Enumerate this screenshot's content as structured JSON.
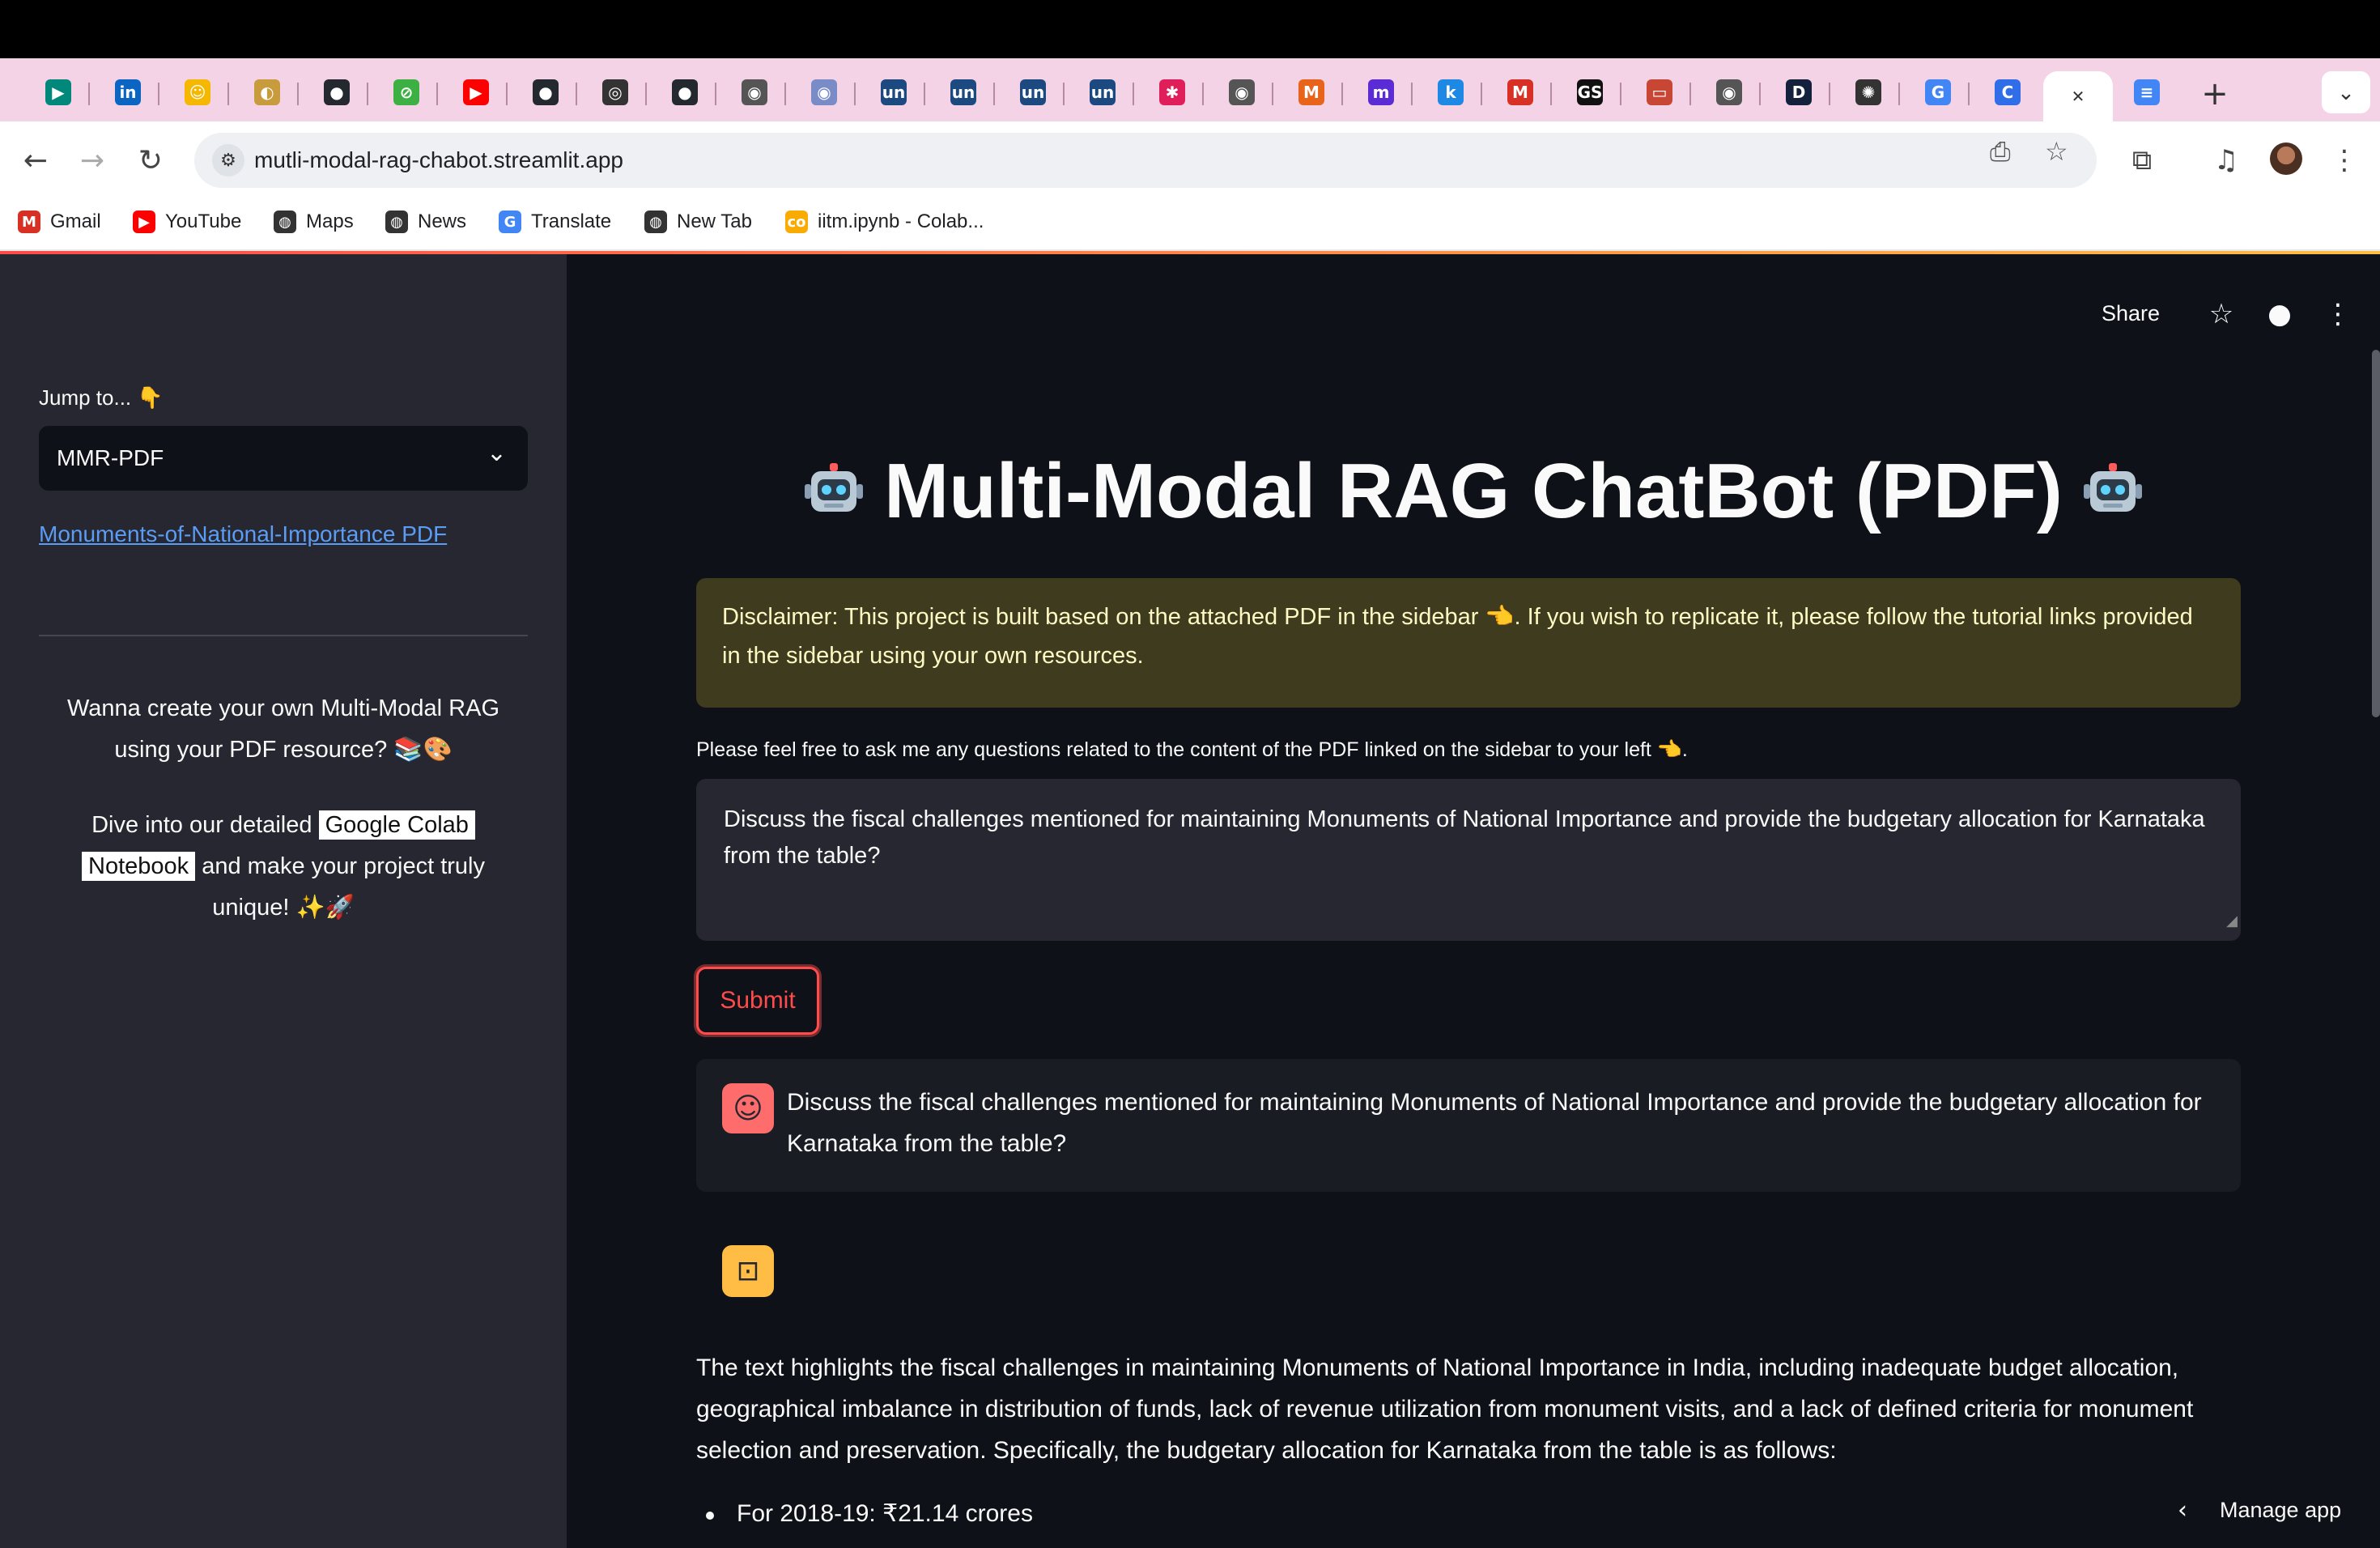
{
  "browser": {
    "tabs": [
      {
        "icon": "google-meet-icon",
        "glyph": "▶",
        "color": "#00897b"
      },
      {
        "icon": "linkedin-icon",
        "glyph": "in",
        "color": "#0a66c2"
      },
      {
        "icon": "huggingface-icon",
        "glyph": "☺",
        "color": "#f5b700"
      },
      {
        "icon": "colab-icon",
        "glyph": "◐",
        "color": "#c89b3c"
      },
      {
        "icon": "github-icon",
        "glyph": "●",
        "color": "#24292f"
      },
      {
        "icon": "green-app-icon",
        "glyph": "⊘",
        "color": "#3cb043"
      },
      {
        "icon": "youtube-icon",
        "glyph": "▶",
        "color": "#ff0000"
      },
      {
        "icon": "github-icon",
        "glyph": "●",
        "color": "#24292f"
      },
      {
        "icon": "openai-icon",
        "glyph": "◎",
        "color": "#333333"
      },
      {
        "icon": "github-icon",
        "glyph": "●",
        "color": "#24292f"
      },
      {
        "icon": "chrome-icon",
        "glyph": "◉",
        "color": "#555555"
      },
      {
        "icon": "chrome-canary-icon",
        "glyph": "◉",
        "color": "#7a8cc7"
      },
      {
        "icon": "unstop-icon",
        "glyph": "un",
        "color": "#1c4980"
      },
      {
        "icon": "unstop-icon",
        "glyph": "un",
        "color": "#1c4980"
      },
      {
        "icon": "unstop-icon",
        "glyph": "un",
        "color": "#1c4980"
      },
      {
        "icon": "unstop-icon",
        "glyph": "un",
        "color": "#1c4980"
      },
      {
        "icon": "slack-icon",
        "glyph": "✱",
        "color": "#e01e5a"
      },
      {
        "icon": "chrome-icon",
        "glyph": "◉",
        "color": "#555555"
      },
      {
        "icon": "orange-app-icon",
        "glyph": "M",
        "color": "#e8641b"
      },
      {
        "icon": "miro-icon",
        "glyph": "m",
        "color": "#5b2bd5"
      },
      {
        "icon": "k-app-icon",
        "glyph": "k",
        "color": "#1e88e5"
      },
      {
        "icon": "gmail-icon",
        "glyph": "M",
        "color": "#d93025"
      },
      {
        "icon": "gs-app-icon",
        "glyph": "GS",
        "color": "#111111"
      },
      {
        "icon": "oracle-icon",
        "glyph": "▭",
        "color": "#c74634"
      },
      {
        "icon": "chrome-icon",
        "glyph": "◉",
        "color": "#555555"
      },
      {
        "icon": "d-app-icon",
        "glyph": "D",
        "color": "#14213d"
      },
      {
        "icon": "chatgpt-icon",
        "glyph": "✺",
        "color": "#333333"
      },
      {
        "icon": "google-icon",
        "glyph": "G",
        "color": "#4285f4"
      },
      {
        "icon": "copilot-icon",
        "glyph": "C",
        "color": "#2f6ee8"
      },
      {
        "icon": "close-icon",
        "glyph": "✕",
        "color": "#333333",
        "active": true
      },
      {
        "icon": "docs-icon",
        "glyph": "≡",
        "color": "#4285f4"
      }
    ],
    "new_tab_glyph": "+",
    "tab_menu_glyph": "⌄",
    "url": "mutli-modal-rag-chabot.streamlit.app",
    "bookmarks": [
      {
        "label": "Gmail",
        "icon": "gmail-icon",
        "glyph": "M",
        "color": "#d93025"
      },
      {
        "label": "YouTube",
        "icon": "youtube-icon",
        "glyph": "▶",
        "color": "#ff0000"
      },
      {
        "label": "Maps",
        "icon": "globe-icon",
        "glyph": "◍",
        "color": "#333333"
      },
      {
        "label": "News",
        "icon": "globe-icon",
        "glyph": "◍",
        "color": "#333333"
      },
      {
        "label": "Translate",
        "icon": "translate-icon",
        "glyph": "G",
        "color": "#4285f4"
      },
      {
        "label": "New Tab",
        "icon": "globe-icon",
        "glyph": "◍",
        "color": "#333333"
      },
      {
        "label": "iitm.ipynb - Colab...",
        "icon": "colab-icon",
        "glyph": "co",
        "color": "#f9ab00"
      }
    ]
  },
  "sidebar": {
    "jump_label": "Jump to... 👇",
    "select_value": "MMR-PDF",
    "pdf_link": "Monuments-of-National-Importance PDF",
    "promo_line1": "Wanna create your own Multi-Modal RAG",
    "promo_line2": "using your PDF resource? 📚🎨",
    "dive_prefix": "Dive into our detailed",
    "colab_part1": "Google Colab",
    "colab_part2": "Notebook",
    "dive_suffix": "and make your project truly",
    "dive_end": "unique! ✨🚀"
  },
  "header": {
    "share": "Share"
  },
  "main": {
    "title": "Multi-Modal RAG ChatBot (PDF)",
    "disclaimer": "Disclaimer: This project is built based on the attached PDF in the sidebar 👈. If you wish to replicate it, please follow the tutorial links provided in the sidebar using your own resources.",
    "helper": "Please feel free to ask me any questions related to the content of the PDF linked on the sidebar to your left 👈.",
    "question_value": "Discuss the fiscal challenges mentioned for maintaining Monuments of National Importance and provide the budgetary allocation for Karnataka from the table?",
    "submit": "Submit",
    "user_message": "Discuss the fiscal challenges mentioned for maintaining Monuments of National Importance and provide the budgetary allocation for Karnataka from the table?",
    "bot_message": "The text highlights the fiscal challenges in maintaining Monuments of National Importance in India, including inadequate budget allocation, geographical imbalance in distribution of funds, lack of revenue utilization from monument visits, and a lack of defined criteria for monument selection and preservation. Specifically, the budgetary allocation for Karnataka from the table is as follows:",
    "bullet_1": "For 2018-19: ₹21.14 crores",
    "manage_app": "Manage app"
  },
  "colors": {
    "accent": "#ff4b4b",
    "sidebar_bg": "#262730",
    "main_bg": "#0e1117",
    "disclaimer_bg": "#3e3b1e",
    "link": "#5b9cf4"
  }
}
